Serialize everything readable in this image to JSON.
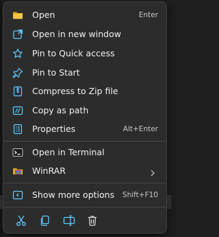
{
  "context_menu": {
    "items": [
      {
        "label": "Open",
        "shortcut": "Enter",
        "icon": "folder-icon"
      },
      {
        "label": "Open in new window",
        "shortcut": "",
        "icon": "open-new-window-icon"
      },
      {
        "label": "Pin to Quick access",
        "shortcut": "",
        "icon": "star-icon"
      },
      {
        "label": "Pin to Start",
        "shortcut": "",
        "icon": "pin-icon"
      },
      {
        "label": "Compress to Zip file",
        "shortcut": "",
        "icon": "zip-icon"
      },
      {
        "label": "Copy as path",
        "shortcut": "",
        "icon": "copy-path-icon"
      },
      {
        "label": "Properties",
        "shortcut": "Alt+Enter",
        "icon": "properties-icon"
      },
      {
        "label": "Open in Terminal",
        "shortcut": "",
        "icon": "terminal-icon"
      },
      {
        "label": "WinRAR",
        "shortcut": "",
        "icon": "winrar-icon",
        "has_submenu": true
      },
      {
        "label": "Show more options",
        "shortcut": "Shift+F10",
        "icon": "more-options-icon"
      }
    ],
    "bottom_actions": [
      {
        "name": "cut",
        "icon": "scissors-icon"
      },
      {
        "name": "copy",
        "icon": "copy-icon"
      },
      {
        "name": "rename",
        "icon": "rename-icon"
      },
      {
        "name": "delete",
        "icon": "trash-icon"
      }
    ]
  },
  "colors": {
    "menu_background": "#2c2c2c",
    "text": "#f2f2f2",
    "accent_blue": "#60cdff",
    "folder_yellow": "#f4c542"
  }
}
